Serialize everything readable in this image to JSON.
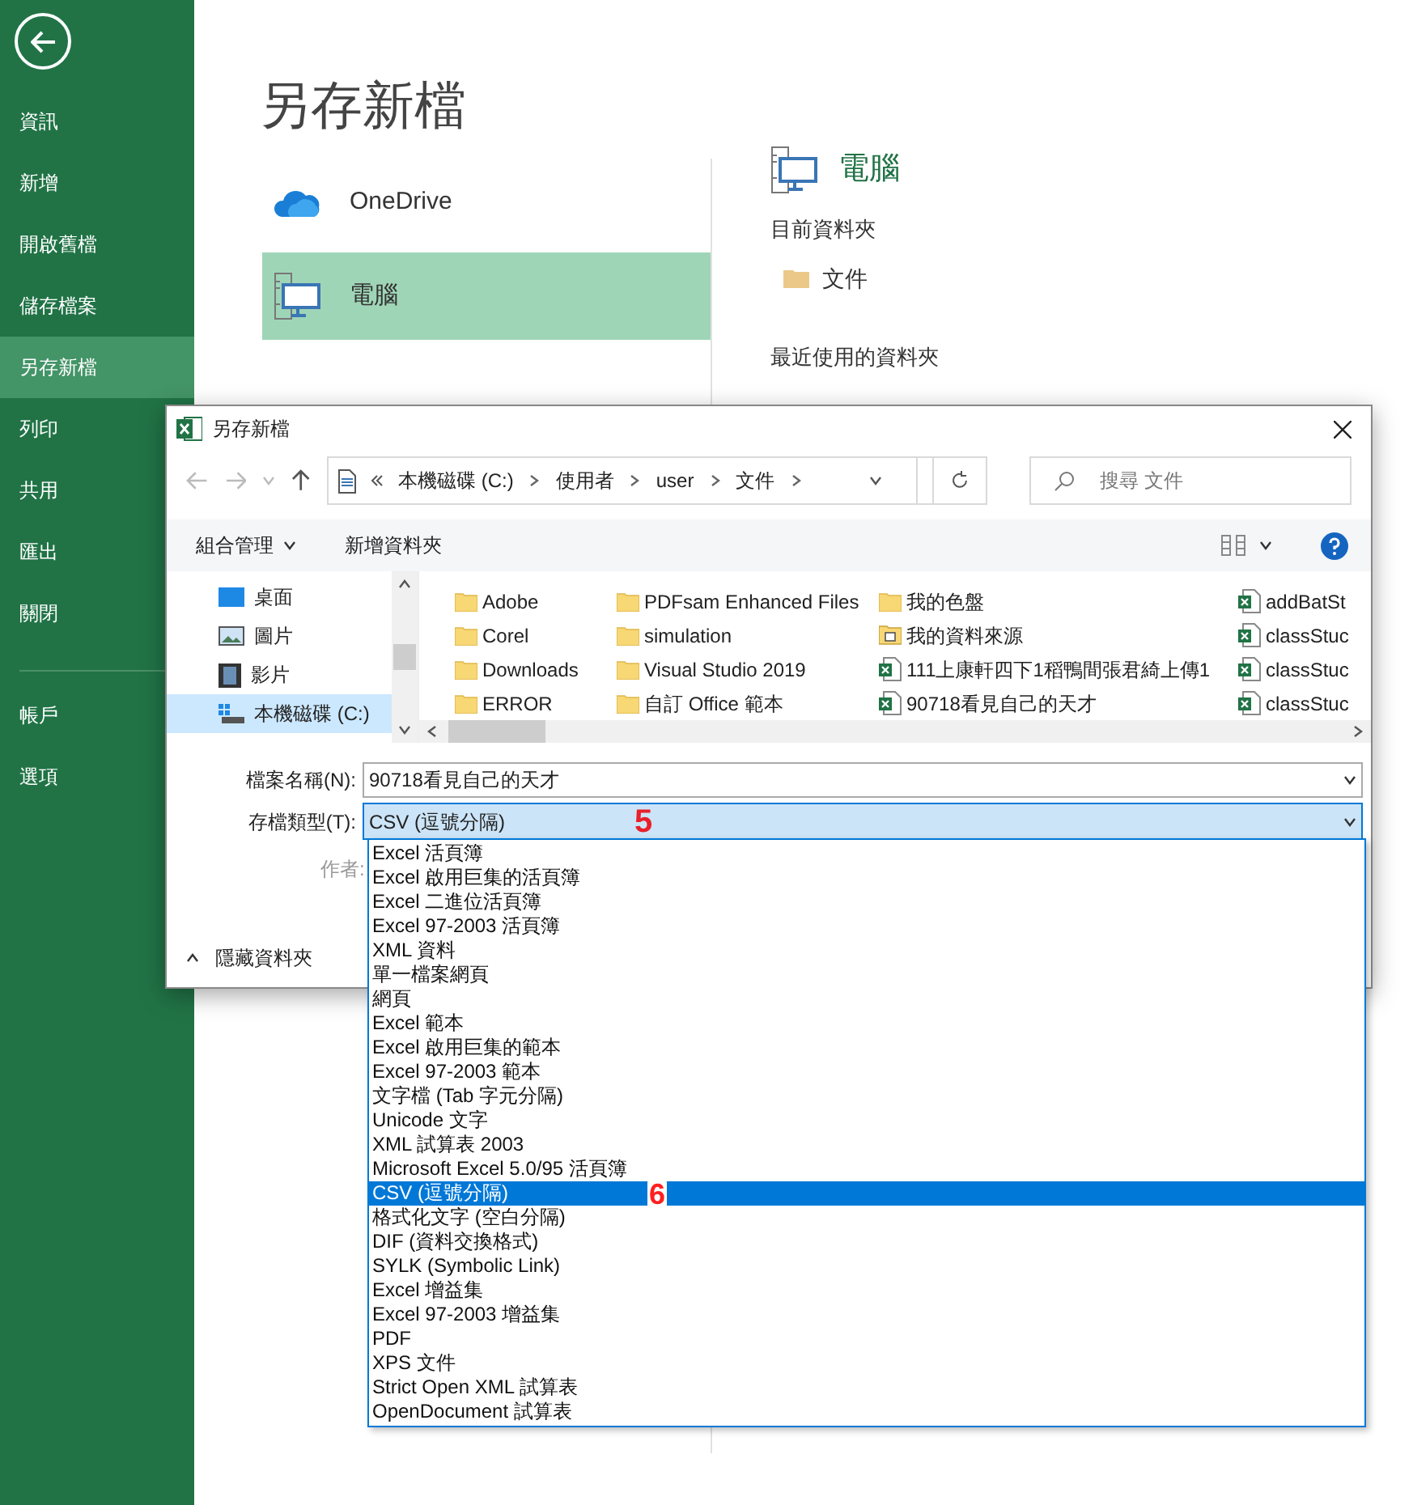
{
  "sidebar": {
    "items": [
      {
        "label": "資訊",
        "selected": false
      },
      {
        "label": "新增",
        "selected": false
      },
      {
        "label": "開啟舊檔",
        "selected": false
      },
      {
        "label": "儲存檔案",
        "selected": false
      },
      {
        "label": "另存新檔",
        "selected": true
      },
      {
        "label": "列印",
        "selected": false
      },
      {
        "label": "共用",
        "selected": false
      },
      {
        "label": "匯出",
        "selected": false
      },
      {
        "label": "關閉",
        "selected": false
      }
    ],
    "bottom_items": [
      {
        "label": "帳戶",
        "selected": false
      },
      {
        "label": "選項",
        "selected": false
      }
    ]
  },
  "page_title": "另存新檔",
  "locations": [
    {
      "kind": "onedrive",
      "label": "OneDrive",
      "selected": false
    },
    {
      "kind": "computer",
      "label": "電腦",
      "selected": true
    }
  ],
  "detail": {
    "title": "電腦",
    "current_heading": "目前資料夾",
    "current_folder": "文件",
    "recent_heading": "最近使用的資料夾"
  },
  "dialog": {
    "title": "另存新檔",
    "breadcrumb": [
      "本機磁碟 (C:)",
      "使用者",
      "user",
      "文件"
    ],
    "search": {
      "placeholder": "搜尋 文件"
    },
    "organize": "組合管理",
    "new_folder": "新增資料夾",
    "nav_items": [
      {
        "kind": "desktop",
        "label": "桌面",
        "selected": false
      },
      {
        "kind": "pictures",
        "label": "圖片",
        "selected": false
      },
      {
        "kind": "videos",
        "label": "影片",
        "selected": false
      },
      {
        "kind": "drive",
        "label": "本機磁碟 (C:)",
        "selected": true
      }
    ],
    "files": [
      {
        "kind": "folder",
        "name": "Adobe"
      },
      {
        "kind": "folder",
        "name": "Corel"
      },
      {
        "kind": "folder",
        "name": "Downloads"
      },
      {
        "kind": "folder",
        "name": "ERROR"
      },
      {
        "kind": "folder",
        "name": "PDFsam Enhanced Files"
      },
      {
        "kind": "folder",
        "name": "simulation"
      },
      {
        "kind": "folder",
        "name": "Visual Studio 2019"
      },
      {
        "kind": "folder",
        "name": "自訂 Office 範本"
      },
      {
        "kind": "folder",
        "name": "我的色盤"
      },
      {
        "kind": "shared",
        "name": "我的資料來源"
      },
      {
        "kind": "excel",
        "name": "111上康軒四下1稻鴨間張君綺上傳1"
      },
      {
        "kind": "excel",
        "name": "90718看見自己的天才"
      },
      {
        "kind": "excel",
        "name": "addBatSt"
      },
      {
        "kind": "excel",
        "name": "classStuc"
      },
      {
        "kind": "excel",
        "name": "classStuc"
      },
      {
        "kind": "excel",
        "name": "classStuc"
      }
    ],
    "filename_label": "檔案名稱(N):",
    "filename": "90718看見自己的天才",
    "filetype_label": "存檔類型(T):",
    "filetype": "CSV (逗號分隔)",
    "filetype_annotation": "5",
    "author_label": "作者:",
    "hide_folders": "隱藏資料夾",
    "filetype_options": [
      {
        "label": "Excel 活頁簿",
        "selected": false
      },
      {
        "label": "Excel 啟用巨集的活頁簿",
        "selected": false
      },
      {
        "label": "Excel 二進位活頁簿",
        "selected": false
      },
      {
        "label": "Excel 97-2003 活頁簿",
        "selected": false
      },
      {
        "label": "XML 資料",
        "selected": false
      },
      {
        "label": "單一檔案網頁",
        "selected": false
      },
      {
        "label": "網頁",
        "selected": false
      },
      {
        "label": "Excel 範本",
        "selected": false
      },
      {
        "label": "Excel 啟用巨集的範本",
        "selected": false
      },
      {
        "label": "Excel 97-2003 範本",
        "selected": false
      },
      {
        "label": "文字檔 (Tab 字元分隔)",
        "selected": false
      },
      {
        "label": "Unicode 文字",
        "selected": false
      },
      {
        "label": "XML 試算表 2003",
        "selected": false
      },
      {
        "label": "Microsoft Excel 5.0/95 活頁簿",
        "selected": false
      },
      {
        "label": "CSV (逗號分隔)",
        "selected": true,
        "annotation": "6"
      },
      {
        "label": "格式化文字 (空白分隔)",
        "selected": false
      },
      {
        "label": "DIF (資料交換格式)",
        "selected": false
      },
      {
        "label": "SYLK (Symbolic Link)",
        "selected": false
      },
      {
        "label": "Excel 增益集",
        "selected": false
      },
      {
        "label": "Excel 97-2003 增益集",
        "selected": false
      },
      {
        "label": "PDF",
        "selected": false
      },
      {
        "label": "XPS 文件",
        "selected": false
      },
      {
        "label": "Strict Open XML 試算表",
        "selected": false
      },
      {
        "label": "OpenDocument 試算表",
        "selected": false
      }
    ]
  }
}
